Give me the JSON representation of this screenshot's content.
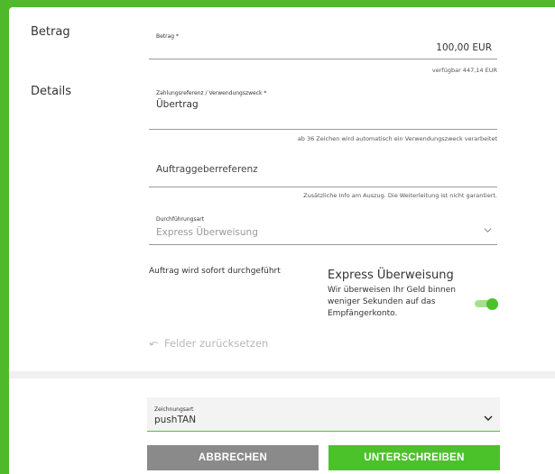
{
  "betrag": {
    "section_label": "Betrag",
    "field_label": "Betrag *",
    "value": "100,00 EUR",
    "available": "verfügbar 447,14 EUR"
  },
  "details": {
    "section_label": "Details",
    "reference_label": "Zahlungsreferenz / Verwendungszweck *",
    "reference_value": "Übertrag",
    "reference_hint": "ab 36 Zeichen wird automatisch ein Verwendungszweck verarbeitet",
    "orderer_placeholder": "Auftraggeberreferenz",
    "orderer_hint": "Zusätzliche Info am Auszug. Die Weiterleitung ist nicht garantiert.",
    "execution_label": "Durchführungsart",
    "execution_value": "Express Überweisung"
  },
  "express": {
    "immediate_text": "Auftrag wird sofort durchgeführt",
    "title": "Express Überweisung",
    "description_lines": [
      "Wir überweisen Ihr Geld binnen",
      "weniger Sekunden auf das",
      "Empfängerkonto."
    ]
  },
  "reset_label": "Felder zurücksetzen",
  "signing": {
    "label": "Zeichnungsart",
    "value": "pushTAN"
  },
  "buttons": {
    "cancel": "ABBRECHEN",
    "sign": "UNTERSCHREIBEN"
  },
  "colors": {
    "accent": "#4cc22a",
    "background": "#4fb92b",
    "cancel_button": "#8a8a8a",
    "sign_button": "#4cc22a"
  }
}
